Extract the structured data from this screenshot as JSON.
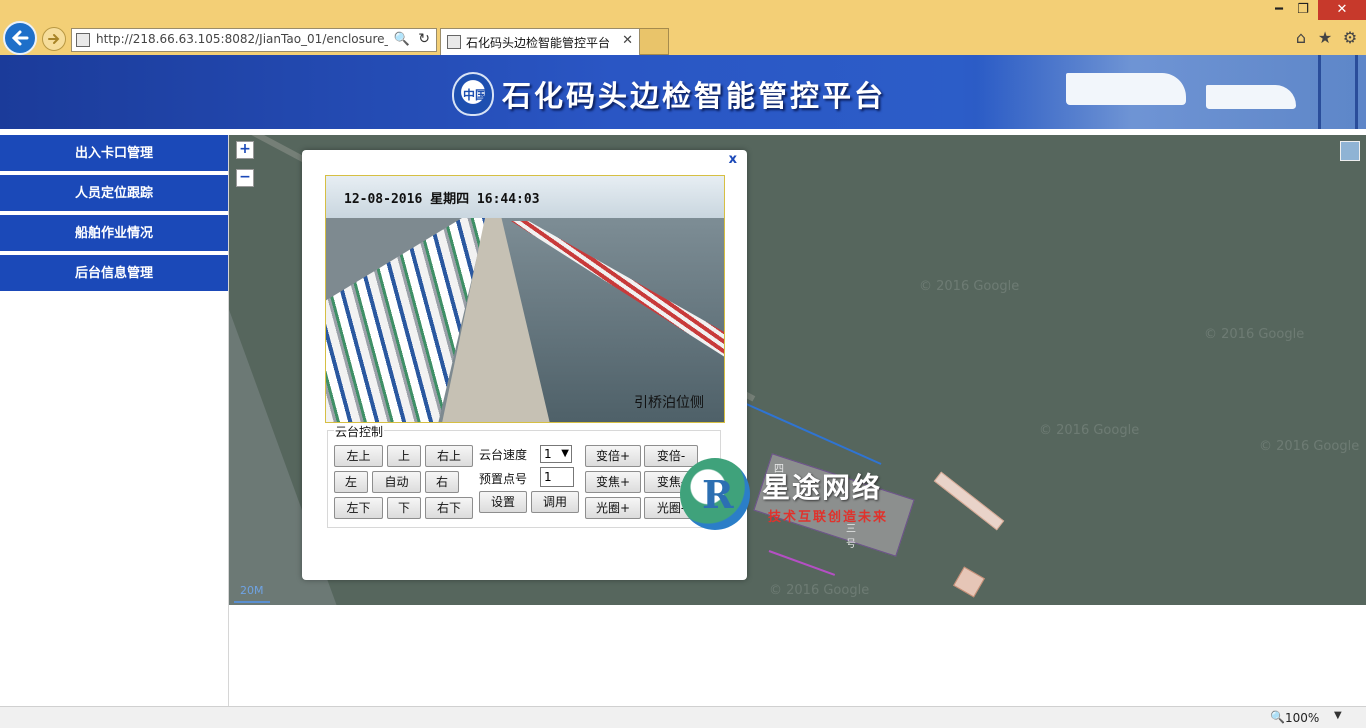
{
  "browser": {
    "url": "http://218.66.63.105:8082/JianTao_01/enclosure_f",
    "tab_title": "石化码头边检智能管控平台",
    "zoom": "100%",
    "search_glyph": "🔍",
    "refresh_glyph": "↻",
    "close_glyph": "✕",
    "win_min": "━",
    "win_max": "❐",
    "win_close": "✕",
    "icons": [
      "back-icon",
      "forward-icon",
      "home-icon",
      "favorites-star-icon",
      "settings-gear-icon"
    ]
  },
  "header": {
    "title": "石化码头边检智能管控平台",
    "emblem_text": "中国"
  },
  "sidebar": {
    "items": [
      {
        "label": "出入卡口管理"
      },
      {
        "label": "人员定位跟踪"
      },
      {
        "label": "船舶作业情况"
      },
      {
        "label": "后台信息管理"
      }
    ]
  },
  "map": {
    "zoom_in": "+",
    "zoom_out": "−",
    "scale": "20M",
    "watermark": "© 2016 Google",
    "label_a": "四号",
    "label_b": "三号"
  },
  "popup": {
    "close": "x",
    "video": {
      "timestamp": "12-08-2016 星期四 16:44:03",
      "camera_label": "引桥泊位侧"
    },
    "ptz": {
      "legend": "云台控制",
      "buttons": {
        "up_left": "左上",
        "up": "上",
        "up_right": "右上",
        "left": "左",
        "auto": "自动",
        "right": "右",
        "down_left": "左下",
        "down": "下",
        "down_right": "右下",
        "set": "设置",
        "call": "调用",
        "zoom_in": "变倍+",
        "zoom_out": "变倍-",
        "focus_in": "变焦+",
        "focus_out": "变焦-",
        "iris_in": "光圈+",
        "iris_out": "光圈-"
      },
      "speed_label": "云台速度",
      "speed_value": "1",
      "preset_label": "预置点号",
      "preset_value": "1"
    }
  },
  "brand_watermark": {
    "letter": "R",
    "name": "星途网络",
    "slogan": "技术互联创造未来"
  },
  "colors": {
    "nav_blue": "#1b49b8",
    "chrome_yellow": "#f3cf76",
    "close_red": "#c7392b"
  }
}
